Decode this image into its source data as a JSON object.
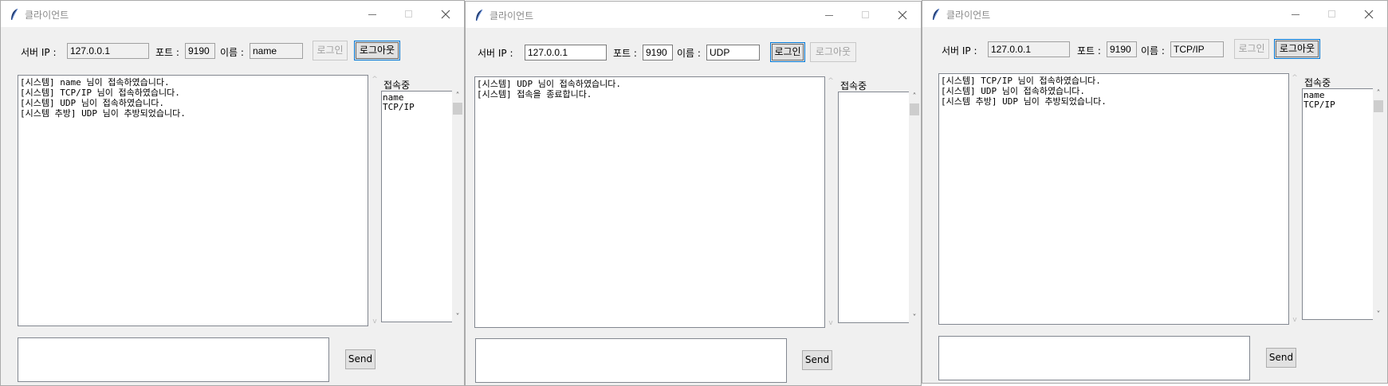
{
  "windows": [
    {
      "title": "클라이언트",
      "server_ip_label": "서버 IP :",
      "server_ip": "127.0.0.1",
      "port_label": "포트 :",
      "port": "9190",
      "name_label": "이름 :",
      "name": "name",
      "login_label": "로그인",
      "logout_label": "로그아웃",
      "connected_label": "접속중",
      "messages": [
        "[시스템] name 님이 접속하였습니다.",
        "[시스템] TCP/IP 님이 접속하였습니다.",
        "[시스템] UDP 님이 접속하였습니다.",
        "[시스템 추방] UDP 님이 추방되었습니다."
      ],
      "users": [
        "name",
        "TCP/IP"
      ],
      "send_label": "Send"
    },
    {
      "title": "클라이언트",
      "server_ip_label": "서버 IP :",
      "server_ip": "127.0.0.1",
      "port_label": "포트 :",
      "port": "9190",
      "name_label": "이름 :",
      "name": "UDP",
      "login_label": "로그인",
      "logout_label": "로그아웃",
      "connected_label": "접속중",
      "messages": [
        "[시스템] UDP 님이 접속하였습니다.",
        "[시스템] 접속을 종료합니다."
      ],
      "users": [],
      "send_label": "Send"
    },
    {
      "title": "클라이언트",
      "server_ip_label": "서버 IP :",
      "server_ip": "127.0.0.1",
      "port_label": "포트 :",
      "port": "9190",
      "name_label": "이름 :",
      "name": "TCP/IP",
      "login_label": "로그인",
      "logout_label": "로그아웃",
      "connected_label": "접속중",
      "messages": [
        "[시스템] TCP/IP 님이 접속하였습니다.",
        "[시스템] UDP 님이 접속하였습니다.",
        "[시스템 추방] UDP 님이 추방되었습니다."
      ],
      "users": [
        "name",
        "TCP/IP"
      ],
      "send_label": "Send"
    }
  ]
}
